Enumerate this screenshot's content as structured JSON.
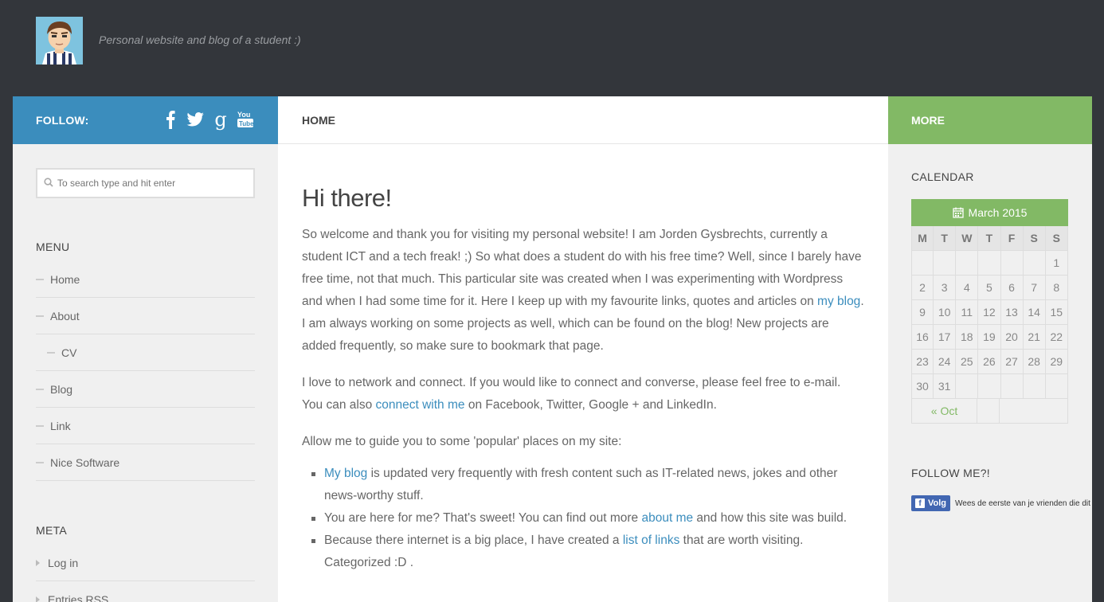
{
  "header": {
    "tagline": "Personal website and blog of a student :)"
  },
  "left": {
    "follow_label": "FOLLOW:",
    "social_icons": [
      "facebook-icon",
      "twitter-icon",
      "google-icon",
      "youtube-icon"
    ],
    "search_placeholder": "To search type and hit enter",
    "menu_title": "MENU",
    "menu_items": [
      "Home",
      "About",
      "CV",
      "Blog",
      "Link",
      "Nice Software"
    ],
    "meta_title": "META",
    "meta_items": [
      "Log in",
      "Entries RSS"
    ]
  },
  "nav": {
    "home": "HOME"
  },
  "main": {
    "title": "Hi there!",
    "p1_a": "So welcome and thank you for visiting my personal website! I am Jorden Gysbrechts, currently a student ICT and a tech freak! ;) So what does a student do with his free time? Well, since I barely have free time, not that much. This particular site was created when I was experimenting with Wordpress and when I had some time for it.  Here I keep up with my favourite links, quotes and articles on ",
    "p1_link": "my blog",
    "p1_b": ". I am always working on some projects as well, which can be found on the blog! New projects are added frequently, so make sure to bookmark that page.",
    "p2_a": "I love to network and connect. If you would like to connect and converse, please feel free to e-mail. You can also ",
    "p2_link": "connect with me",
    "p2_b": " on Facebook, Twitter, Google + and LinkedIn.",
    "p3": "Allow me to guide you to some 'popular' places on my site:",
    "li1_link": "My blog",
    "li1_text": " is updated very frequently with fresh content such as IT-related news, jokes and other news-worthy stuff.",
    "li2_a": "You are here for me? That's sweet! You can find out more ",
    "li2_link": "about me",
    "li2_b": " and how this site was build.",
    "li3_a": "Because there internet is a big place, I have created a ",
    "li3_link": "list of links",
    "li3_b": " that are worth visiting. Categorized :D ."
  },
  "right": {
    "more_label": "MORE",
    "calendar_title": "CALENDAR",
    "calendar_caption": "March 2015",
    "weekdays": [
      "M",
      "T",
      "W",
      "T",
      "F",
      "S",
      "S"
    ],
    "weeks": [
      [
        "",
        "",
        "",
        "",
        "",
        "",
        "1"
      ],
      [
        "2",
        "3",
        "4",
        "5",
        "6",
        "7",
        "8"
      ],
      [
        "9",
        "10",
        "11",
        "12",
        "13",
        "14",
        "15"
      ],
      [
        "16",
        "17",
        "18",
        "19",
        "20",
        "21",
        "22"
      ],
      [
        "23",
        "24",
        "25",
        "26",
        "27",
        "28",
        "29"
      ],
      [
        "30",
        "31",
        "",
        "",
        "",
        "",
        ""
      ]
    ],
    "prev_link": "« Oct",
    "follow_title": "FOLLOW ME?!",
    "fb_button": "Volg",
    "fb_text": "Wees de eerste van je vrienden die dit leuk vindt."
  },
  "colors": {
    "header_bg": "#33363b",
    "follow_bar": "#3b8dbd",
    "more_bar": "#82b965",
    "link": "#3b8dbd",
    "green_link": "#82b965"
  }
}
